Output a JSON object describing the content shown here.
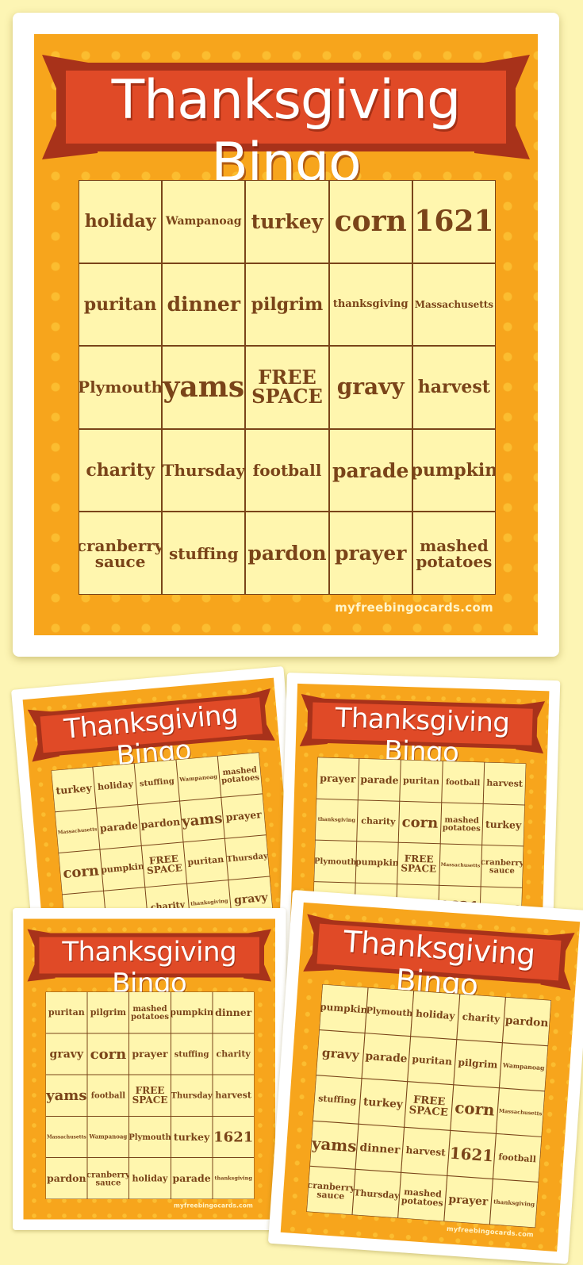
{
  "site": "myfreebingocards.com",
  "colors": {
    "background": "#fdf5b4",
    "sheet": "#f7a51c",
    "ribbon": "#e04a27",
    "ribbon_dark": "#a8321a",
    "cell": "#fff6ae",
    "text": "#7a4419"
  },
  "cards": [
    {
      "title": "Thanksgiving Bingo",
      "footer": "myfreebingocards.com",
      "cells": [
        "holiday",
        "Wampanoag",
        "turkey",
        "corn",
        "1621",
        "puritan",
        "dinner",
        "pilgrim",
        "thanksgiving",
        "Massachusetts",
        "Plymouth",
        "yams",
        "FREE SPACE",
        "gravy",
        "harvest",
        "charity",
        "Thursday",
        "football",
        "parade",
        "pumpkin",
        "cranberry sauce",
        "stuffing",
        "pardon",
        "prayer",
        "mashed potatoes"
      ]
    },
    {
      "title": "Thanksgiving Bingo",
      "footer": "",
      "cells": [
        "turkey",
        "holiday",
        "stuffing",
        "Wampanoag",
        "mashed potatoes",
        "Massachusetts",
        "parade",
        "pardon",
        "yams",
        "prayer",
        "corn",
        "pumpkin",
        "FREE SPACE",
        "puritan",
        "Thursday",
        "",
        "",
        "charity",
        "thanksgiving",
        "gravy",
        "",
        "",
        "",
        "",
        ""
      ]
    },
    {
      "title": "Thanksgiving Bingo",
      "footer": "",
      "cells": [
        "prayer",
        "parade",
        "puritan",
        "football",
        "harvest",
        "thanksgiving",
        "charity",
        "corn",
        "mashed potatoes",
        "turkey",
        "Plymouth",
        "pumpkin",
        "FREE SPACE",
        "Massachusetts",
        "cranberry sauce",
        "",
        "dinner",
        "stuffing",
        "1621",
        "yams",
        "",
        "",
        "",
        "",
        ""
      ]
    },
    {
      "title": "Thanksgiving Bingo",
      "footer": "myfreebingocards.com",
      "cells": [
        "puritan",
        "pilgrim",
        "mashed potatoes",
        "pumpkin",
        "dinner",
        "gravy",
        "corn",
        "prayer",
        "stuffing",
        "charity",
        "yams",
        "football",
        "FREE SPACE",
        "Thursday",
        "harvest",
        "Massachusetts",
        "Wampanoag",
        "Plymouth",
        "turkey",
        "1621",
        "pardon",
        "cranberry sauce",
        "holiday",
        "parade",
        "thanksgiving"
      ]
    },
    {
      "title": "Thanksgiving Bingo",
      "footer": "myfreebingocards.com",
      "cells": [
        "pumpkin",
        "Plymouth",
        "holiday",
        "charity",
        "pardon",
        "gravy",
        "parade",
        "puritan",
        "pilgrim",
        "Wampanoag",
        "stuffing",
        "turkey",
        "FREE SPACE",
        "corn",
        "Massachusetts",
        "yams",
        "dinner",
        "harvest",
        "1621",
        "football",
        "cranberry sauce",
        "Thursday",
        "mashed potatoes",
        "prayer",
        "thanksgiving"
      ]
    }
  ]
}
